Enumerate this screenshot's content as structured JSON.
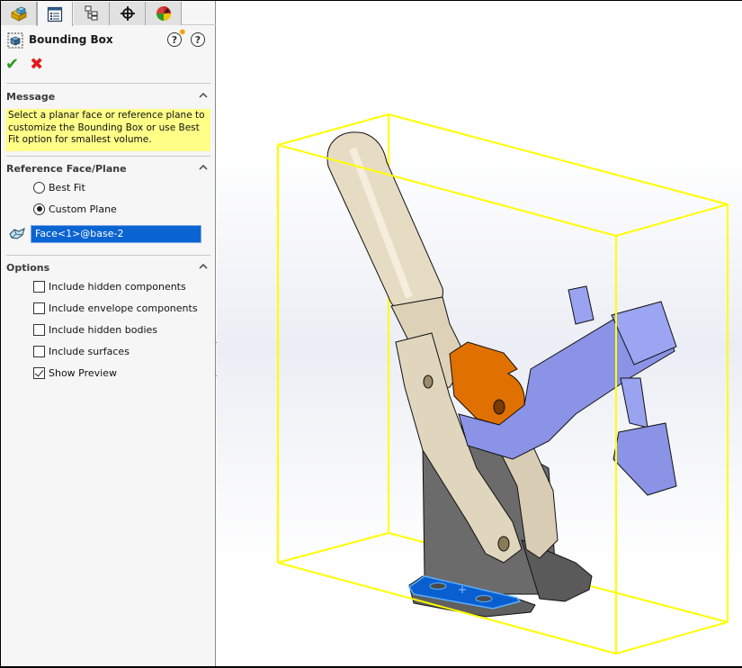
{
  "tabs": [
    {
      "name": "feature-manager",
      "icon": "part-icon"
    },
    {
      "name": "property-manager",
      "icon": "property-manager-icon",
      "active": true
    },
    {
      "name": "configuration-manager",
      "icon": "configuration-tree-icon"
    },
    {
      "name": "dimxpert-manager",
      "icon": "crosshair-icon"
    },
    {
      "name": "display-manager",
      "icon": "appearance-ball-icon"
    }
  ],
  "header": {
    "title": "Bounding Box",
    "whats_new_icon": "?",
    "help_icon": "?"
  },
  "actions": {
    "ok": "✔",
    "cancel": "✖"
  },
  "message_group": {
    "label": "Message",
    "text": "Select a planar face or reference plane to customize the Bounding Box or use Best Fit option for smallest volume."
  },
  "reference_group": {
    "label": "Reference Face/Plane",
    "options": [
      {
        "label": "Best Fit",
        "selected": false
      },
      {
        "label": "Custom Plane",
        "selected": true
      }
    ],
    "selection_value": "Face<1>@base-2"
  },
  "options_group": {
    "label": "Options",
    "checkboxes": [
      {
        "label": "Include hidden components",
        "checked": false
      },
      {
        "label": "Include envelope components",
        "checked": false
      },
      {
        "label": "Include hidden bodies",
        "checked": false
      },
      {
        "label": "Include surfaces",
        "checked": false
      },
      {
        "label": "Show Preview",
        "checked": true
      }
    ]
  },
  "viewport": {
    "model": "toggle clamp assembly",
    "bounding_box_color": "#ffff00",
    "selected_face_color": "#0a5fd0",
    "colors": {
      "handle": "#e0d6c0",
      "base": "#6b6b6b",
      "link": "#e07000",
      "arm": "#8a93e6"
    }
  }
}
